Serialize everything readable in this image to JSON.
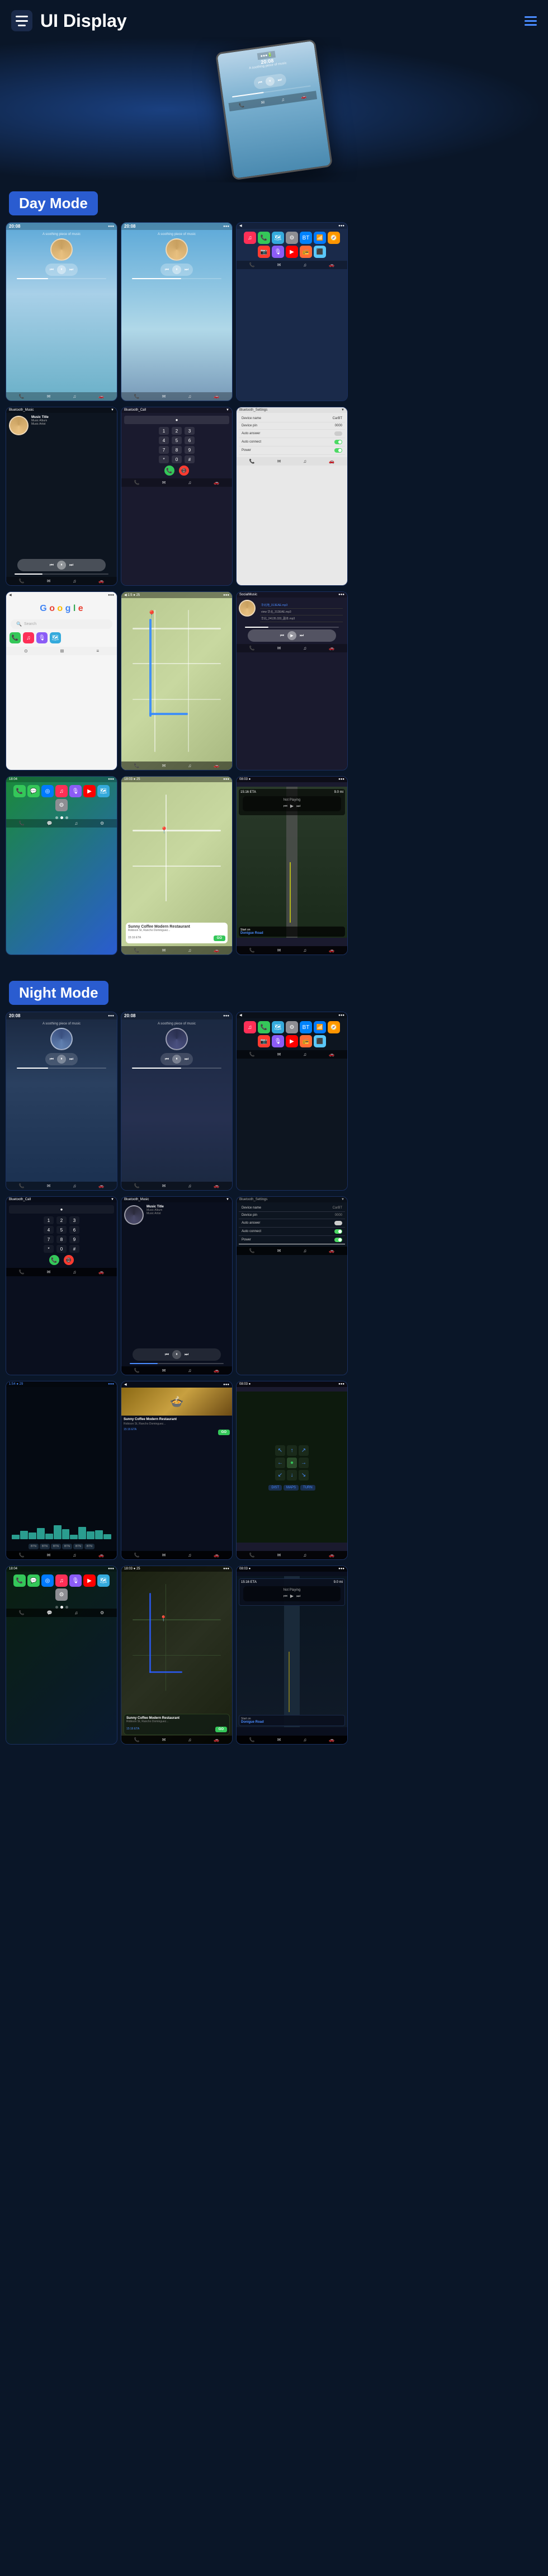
{
  "header": {
    "title": "UI Display",
    "menu_icon": "menu-icon",
    "dots_icon": "hamburger-dots-icon"
  },
  "sections": {
    "day_mode": "Day Mode",
    "night_mode": "Night Mode"
  },
  "screens": {
    "home_time": "20:08",
    "music_title": "Music Title",
    "music_album": "Music Album",
    "music_artist": "Music Artist",
    "bluetooth_music": "Bluetooth_Music",
    "bluetooth_call": "Bluetooth_Call",
    "bluetooth_settings": "Bluetooth_Settings",
    "device_name_label": "Device name",
    "device_name_value": "CarBT",
    "device_pin_label": "Device pin",
    "device_pin_value": "0000",
    "auto_answer_label": "Auto answer",
    "auto_connect_label": "Auto connect",
    "power_label": "Power",
    "google_text": "Google",
    "sunny_coffee": "Sunny Coffee Modern Restaurant",
    "sunny_addr": "Robison St, Rancho Dominguez...",
    "eta_label": "15:16 ETA",
    "eta_dist": "9.0 mi",
    "go_btn": "GO",
    "start_label": "Start on",
    "street_label": "Donigue Road",
    "not_playing": "Not Playing",
    "social_music": "SocialMusic",
    "song1": "华北地_313EAE.mp3",
    "song2": "view 华北_313EAE.mp3",
    "song3": "华北_24135.333_副本.mp3"
  },
  "app_colors": {
    "tel": "#34c759",
    "msg": "#34c759",
    "music": "#fc3158",
    "maps": "#34aadc",
    "settings": "#8e8e93",
    "spotify": "#1db954",
    "bt": "#0082fc",
    "wifi": "#007aff",
    "nav": "#ff9500",
    "cam": "#ff3b30",
    "pod": "#8b5cf6",
    "yt": "#ff0000",
    "radio": "#ff6b35",
    "app": "#5ac8fa",
    "blue_accent": "#2a5cd0"
  }
}
